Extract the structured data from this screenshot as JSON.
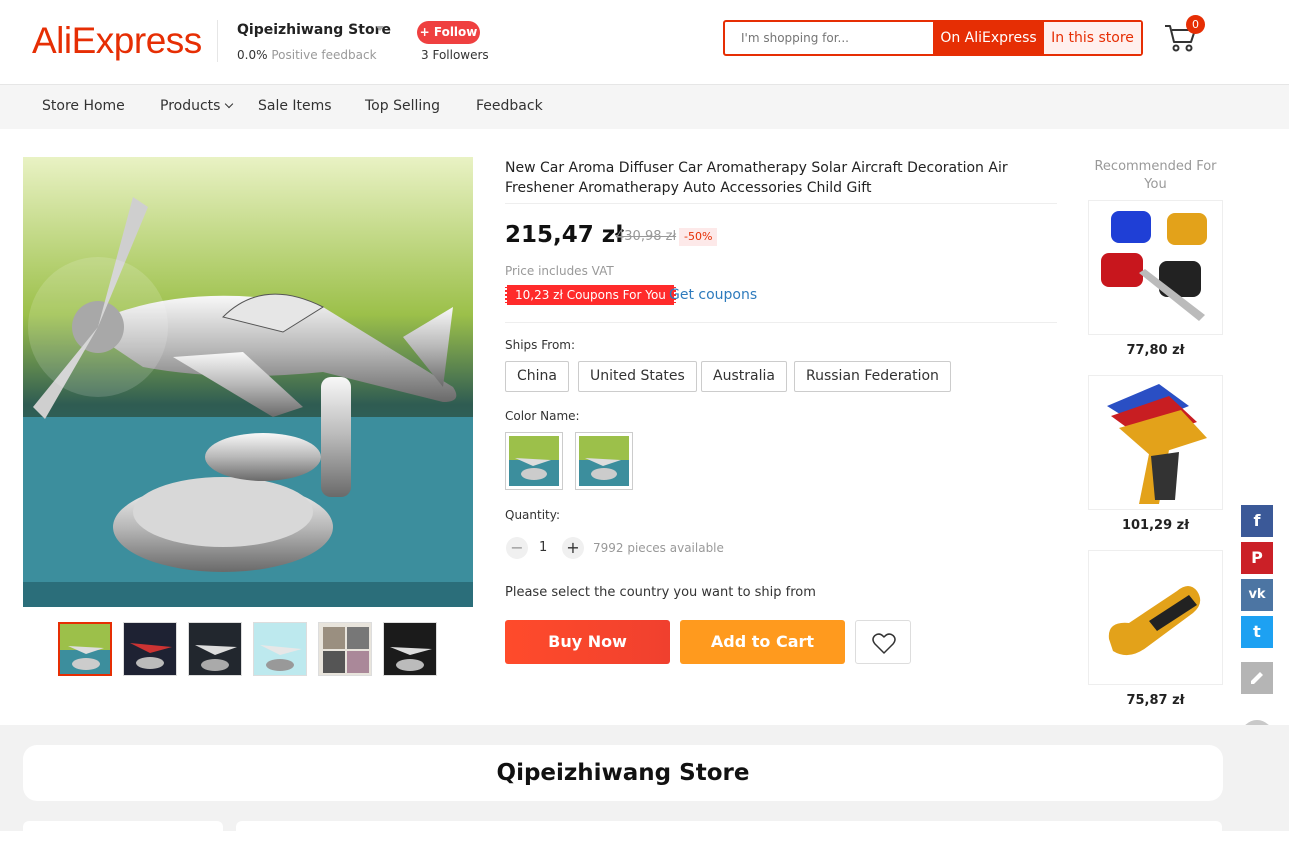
{
  "header": {
    "logo": "AliExpress",
    "store_name": "Qipeizhiwang Store",
    "feedback_value": "0.0%",
    "feedback_label": "Positive feedback",
    "follow_label": "+ Follow",
    "followers_count": "3",
    "followers_label": "Followers",
    "search_placeholder": "I'm shopping for...",
    "search_btn_aliexpress": "On AliExpress",
    "search_btn_store": "In this store",
    "cart_count": "0",
    "brand_color": "#e62e04"
  },
  "nav": {
    "items": [
      "Store Home",
      "Products",
      "Sale Items",
      "Top Selling",
      "Feedback"
    ]
  },
  "product": {
    "title": "New Car Aroma Diffuser Car Aromatherapy Solar Aircraft Decoration Air Freshener Aromatherapy Auto Accessories Child Gift",
    "price": "215,47 zł",
    "old_price": "430,98 zł",
    "discount": "-50%",
    "vat_note": "Price includes VAT",
    "coupon": "10,23 zł Coupons For You",
    "get_coupons": "Get coupons",
    "ships_from_label": "Ships From:",
    "ships_from": [
      "China",
      "United States",
      "Australia",
      "Russian Federation"
    ],
    "color_label": "Color Name:",
    "quantity_label": "Quantity:",
    "quantity": "1",
    "minus": "−",
    "plus": "+",
    "available": "7992 pieces available",
    "country_message": "Please select the country you want to ship from",
    "buy_now": "Buy Now",
    "add_to_cart": "Add to Cart"
  },
  "recommended": {
    "title": "Recommended For You",
    "items": [
      {
        "price": "77,80 zł"
      },
      {
        "price": "101,29 zł"
      },
      {
        "price": "75,87 zł"
      }
    ]
  },
  "social": {
    "facebook": "f",
    "pinterest": "P",
    "vk": "vk",
    "twitter": "t",
    "facebook_color": "#3b5998",
    "pinterest_color": "#cb2027",
    "vk_color": "#4c75a3",
    "twitter_color": "#1da1f2"
  },
  "bottom": {
    "store_banner": "Qipeizhiwang Store"
  }
}
